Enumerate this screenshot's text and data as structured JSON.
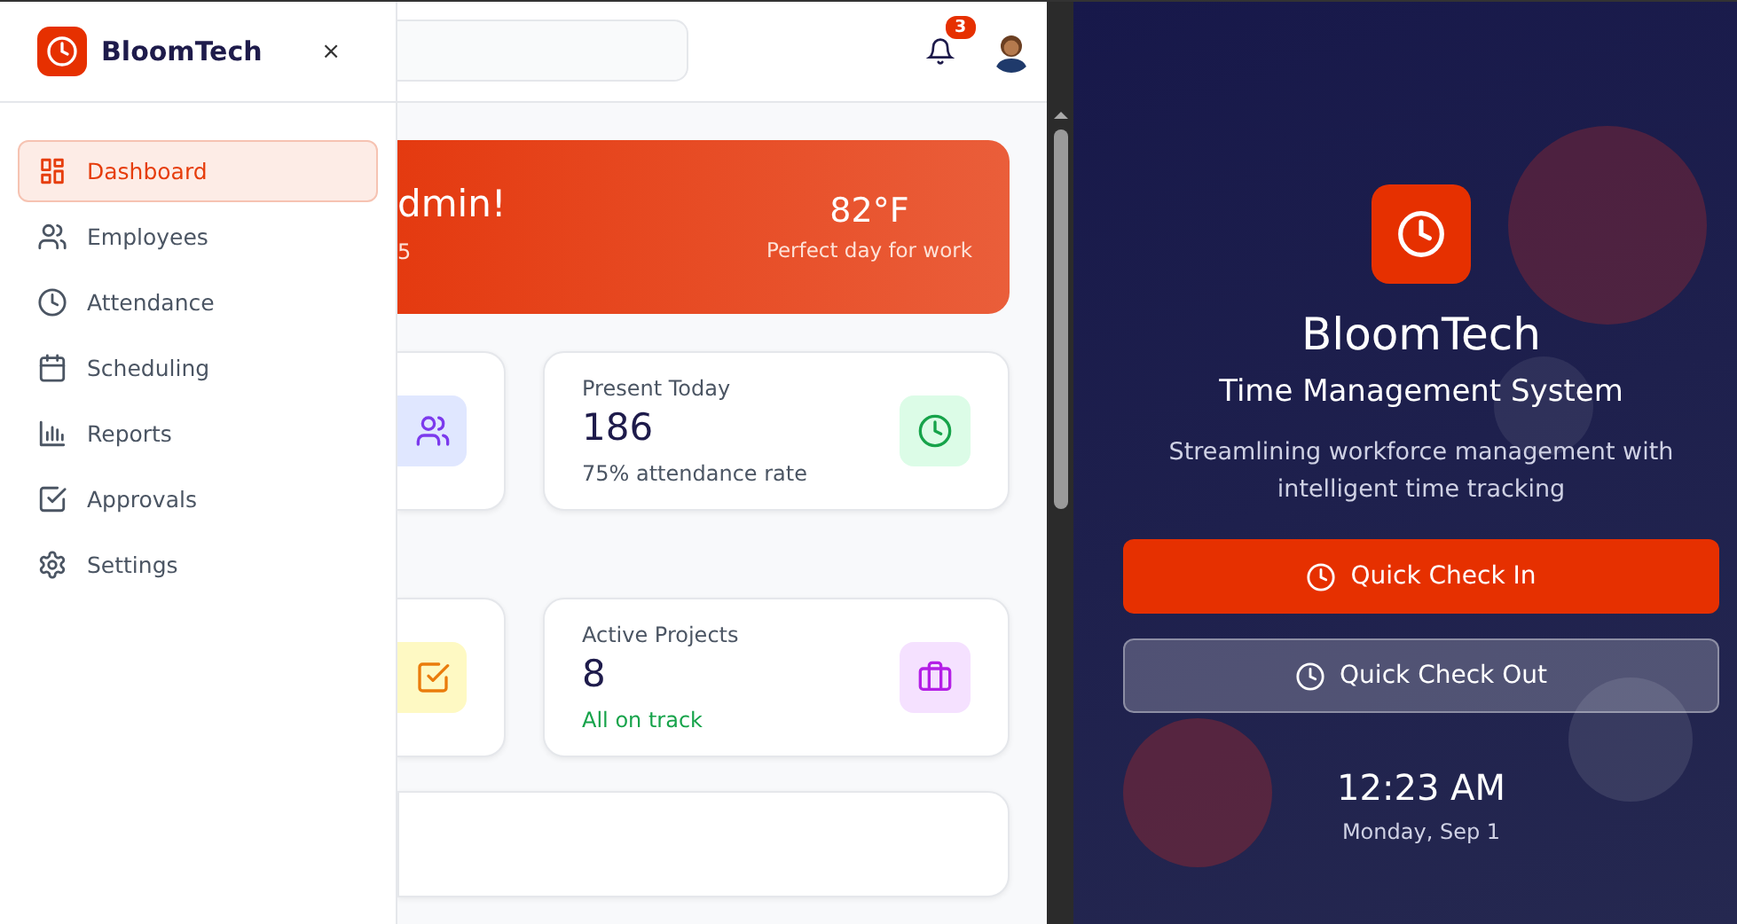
{
  "sidebar": {
    "brand": "BloomTech",
    "close": "×",
    "items": [
      {
        "label": "Dashboard",
        "selected": true
      },
      {
        "label": "Employees",
        "selected": false
      },
      {
        "label": "Attendance",
        "selected": false
      },
      {
        "label": "Scheduling",
        "selected": false
      },
      {
        "label": "Reports",
        "selected": false
      },
      {
        "label": "Approvals",
        "selected": false
      },
      {
        "label": "Settings",
        "selected": false
      }
    ]
  },
  "header": {
    "notifications": "3"
  },
  "banner": {
    "greeting": "dmin!",
    "subtitle": "5",
    "temperature": "82°F",
    "weather_note": "Perfect day for work"
  },
  "stats": [
    {
      "kind": "cut"
    },
    {
      "kind": "full",
      "title": "Present Today",
      "value": "186",
      "note": "75% attendance rate"
    },
    {
      "kind": "cut"
    },
    {
      "kind": "full",
      "title": "Active Projects",
      "value": "8",
      "note": "All on track"
    }
  ],
  "hero": {
    "brand": "BloomTech",
    "title": "Time Management System",
    "description": "Streamlining workforce management with intelligent time tracking",
    "actions": [
      {
        "label": "Quick Check In",
        "kind": "primary"
      },
      {
        "label": "Quick Check Out",
        "kind": "secondary"
      }
    ],
    "time": "12:23 AM",
    "date": "Monday, Sep 1"
  }
}
